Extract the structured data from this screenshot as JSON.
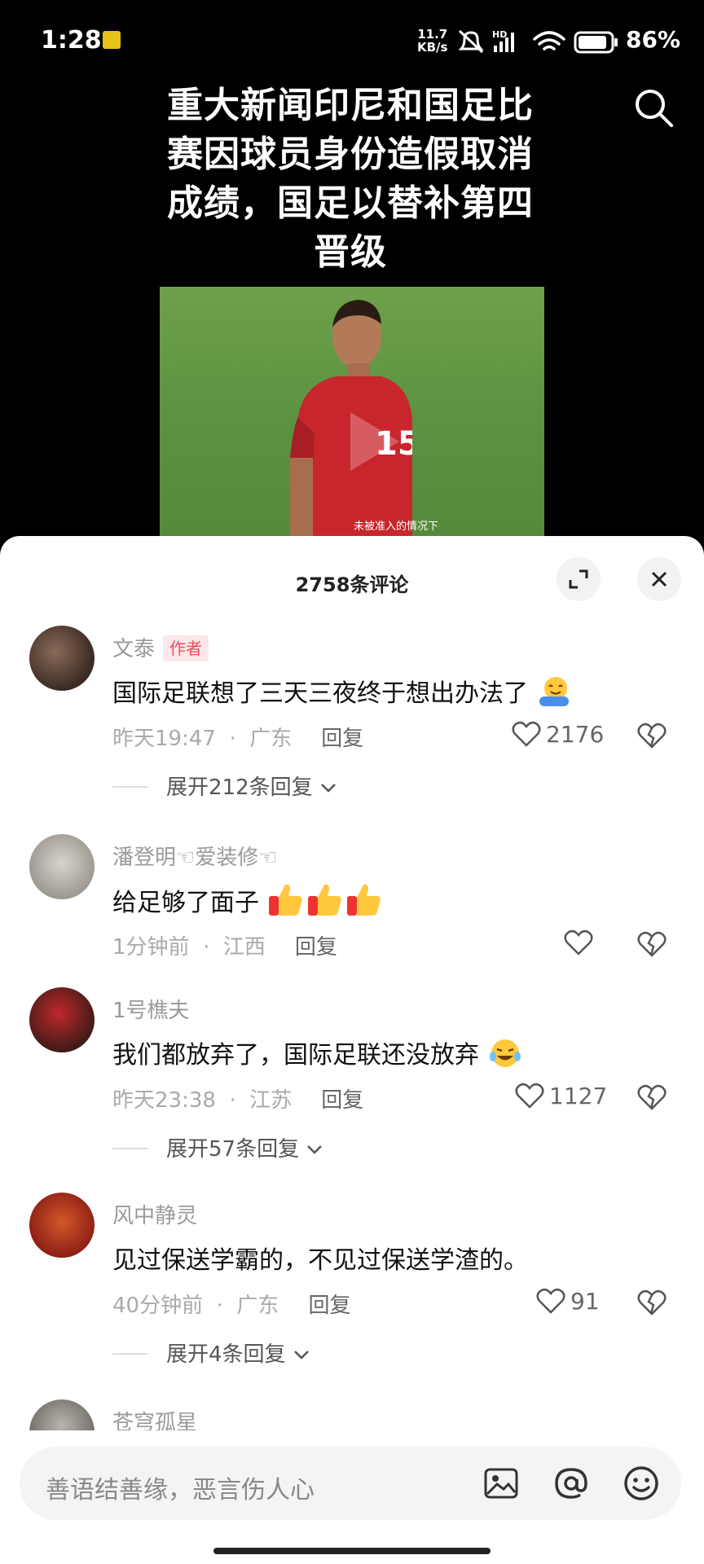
{
  "status_bar": {
    "time": "1:28",
    "net_speed_top": "11.7",
    "net_speed_bottom": "KB/s",
    "network_type": "HD",
    "battery": "86%"
  },
  "video": {
    "headline": "重大新闻印尼和国足比赛因球员身份造假取消成绩，国足以替补第四晋级",
    "jersey_number": "15",
    "subtitle": "未被准入的情况下"
  },
  "sheet": {
    "title": "2758条评论"
  },
  "comments": [
    {
      "username": "文泰",
      "badge": "作者",
      "text": "国际足联想了三天三夜终于想出办法了",
      "time": "昨天19:47",
      "location": "广东",
      "reply_label": "回复",
      "likes": "2176",
      "expand": "展开212条回复"
    },
    {
      "username": "潘登明☜爱装修☜",
      "text": "给足够了面子",
      "time": "1分钟前",
      "location": "江西",
      "reply_label": "回复",
      "likes": ""
    },
    {
      "username": "1号樵夫",
      "text": "我们都放弃了，国际足联还没放弃",
      "time": "昨天23:38",
      "location": "江苏",
      "reply_label": "回复",
      "likes": "1127",
      "expand": "展开57条回复"
    },
    {
      "username": "风中静灵",
      "text": "见过保送学霸的，不见过保送学渣的。",
      "time": "40分钟前",
      "location": "广东",
      "reply_label": "回复",
      "likes": "91",
      "expand": "展开4条回复"
    },
    {
      "username": "苍穹孤星"
    }
  ],
  "input": {
    "placeholder": "善语结善缘，恶言伤人心"
  },
  "colors": {
    "badge_bg": "#fde7ea",
    "badge_text": "#f04a5f",
    "muted_text": "#9a9a9a"
  }
}
